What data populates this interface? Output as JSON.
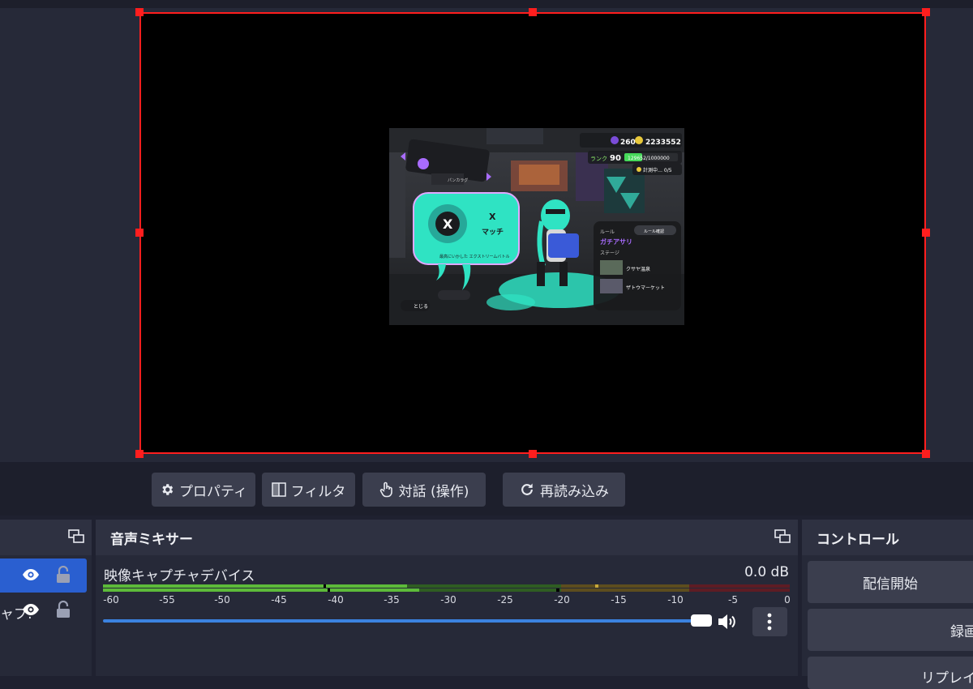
{
  "toolbar": {
    "properties_label": "プロパティ",
    "filters_label": "フィルタ",
    "interact_label": "対話 (操作)",
    "reload_label": "再読み込み"
  },
  "scenes_dock": {
    "rows": [
      {
        "label": "",
        "selected": true
      },
      {
        "label": "ャプ:",
        "selected": false
      }
    ]
  },
  "mixer": {
    "title": "音声ミキサー",
    "track_name": "映像キャプチャデバイス",
    "volume_db": "0.0 dB",
    "volume_fraction": 1.0,
    "scale": [
      "-60",
      "-55",
      "-50",
      "-45",
      "-40",
      "-35",
      "-30",
      "-25",
      "-20",
      "-15",
      "-10",
      "-5",
      "0"
    ]
  },
  "controls": {
    "title": "コントロール",
    "buttons": [
      "配信開始",
      "録画",
      "リプレイバ"
    ]
  },
  "game": {
    "level": "260",
    "coins": "2233552",
    "rank_label": "ランク",
    "rank": "90",
    "xp": "129652/1000000",
    "challenge": "計測中… 0/5",
    "mode_badge": "X",
    "mode_title": "X",
    "mode_sub": "マッチ",
    "mode_desc": "最高にいかした エクストリームバトル",
    "rules_header": "ルール",
    "rules_button": "ルール確認",
    "rule": "ガチアサリ",
    "stage_header": "ステージ",
    "stages": [
      "クサヤ温泉",
      "ザトウマーケット"
    ],
    "back_label": "とじる",
    "colors": {
      "ink": "#2fe3c3",
      "accent": "#a96cff"
    }
  },
  "colors": {
    "selection": "#ff1e1e",
    "selected_row": "#2a5fd0",
    "slider": "#3b82e0",
    "meter_green": "#5dbb3a",
    "meter_yellow": "#c8a83a",
    "meter_red": "#b8333e"
  }
}
